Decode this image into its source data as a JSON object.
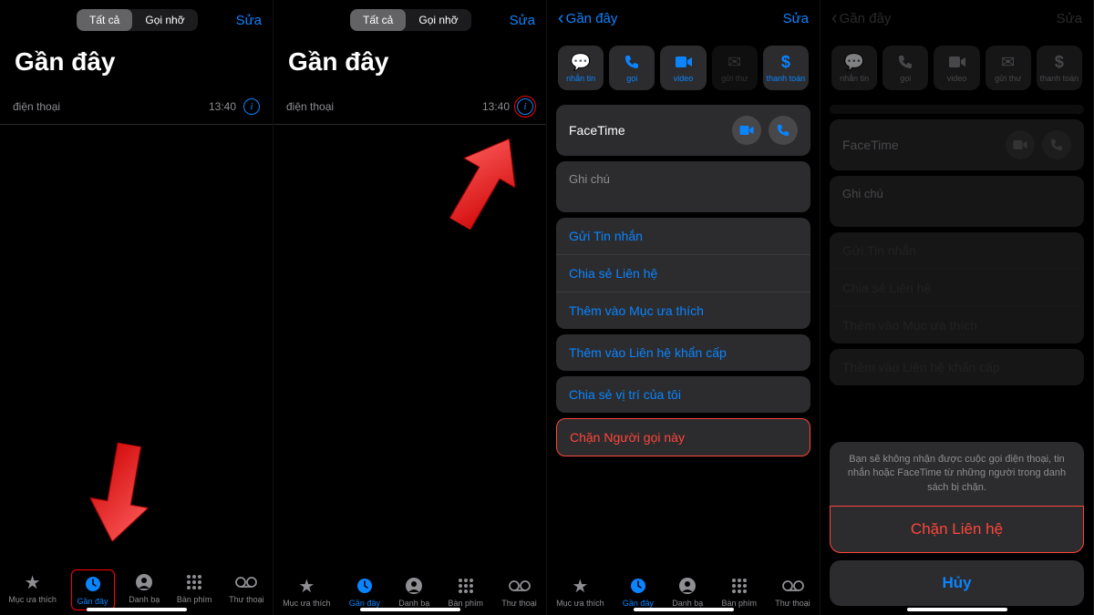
{
  "seg": {
    "all": "Tất cả",
    "missed": "Gọi nhỡ"
  },
  "edit": "Sửa",
  "title": "Gần đây",
  "back": "Gần đây",
  "row": {
    "phone": "điện thoại",
    "time": "13:40"
  },
  "tabs": {
    "fav": "Mục ưa thích",
    "recent": "Gần đây",
    "contacts": "Danh bạ",
    "keypad": "Bàn phím",
    "voicemail": "Thư thoại"
  },
  "actions": {
    "message": "nhắn tin",
    "call": "gọi",
    "video": "video",
    "mail": "gửi thư",
    "pay": "thanh toán"
  },
  "facetime": "FaceTime",
  "notes": "Ghi chú",
  "menu": {
    "send": "Gửi Tin nhắn",
    "share": "Chia sẻ Liên hệ",
    "addfav": "Thêm vào Mục ưa thích",
    "emergency": "Thêm vào Liên hệ khẩn cấp",
    "location": "Chia sẻ vị trí của tôi",
    "block": "Chặn Người gọi này"
  },
  "sheet": {
    "msg": "Bạn sẽ không nhận được cuộc gọi điện thoại, tin nhắn hoặc FaceTime từ những người trong danh sách bị chặn.",
    "block": "Chặn Liên hệ",
    "cancel": "Hủy"
  }
}
